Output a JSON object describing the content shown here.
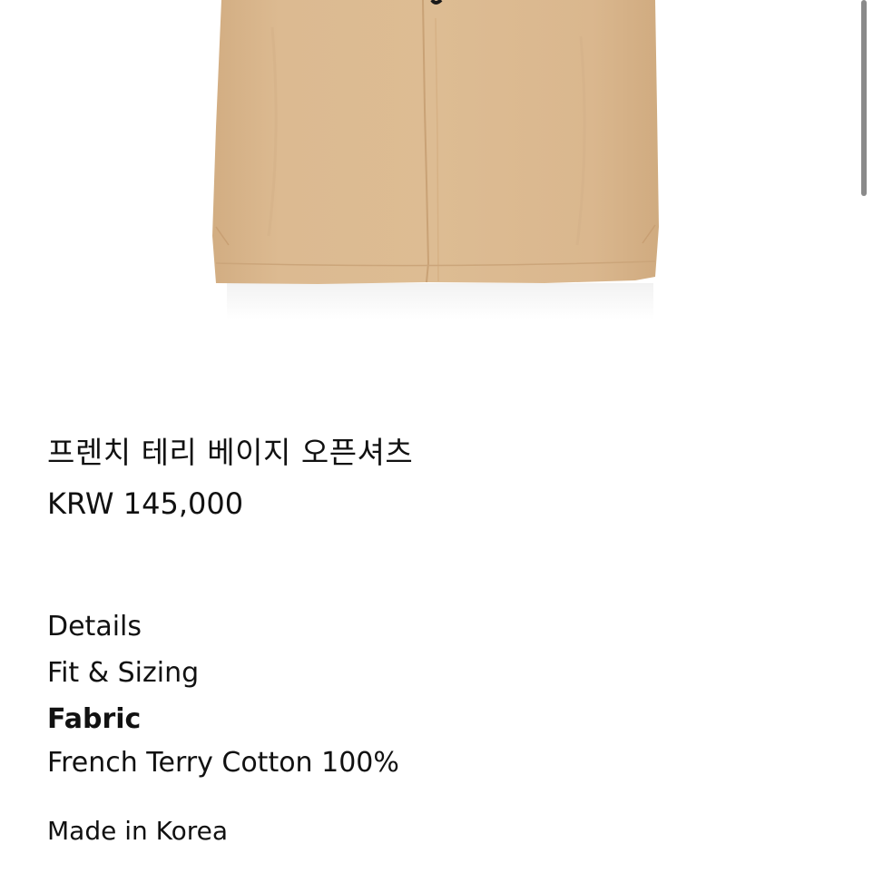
{
  "product": {
    "image_alt": "beige open shirt bottom hem",
    "shirt_color": "#d9b68c",
    "title": "프렌치 테리 베이지 오픈셔츠",
    "price": "KRW 145,000"
  },
  "accordion": {
    "items": [
      {
        "label": "Details",
        "active": false
      },
      {
        "label": "Fit & Sizing",
        "active": false
      },
      {
        "label": "Fabric",
        "active": true
      }
    ],
    "fabric_content": "French Terry Cotton 100%",
    "origin": "Made in Korea"
  }
}
